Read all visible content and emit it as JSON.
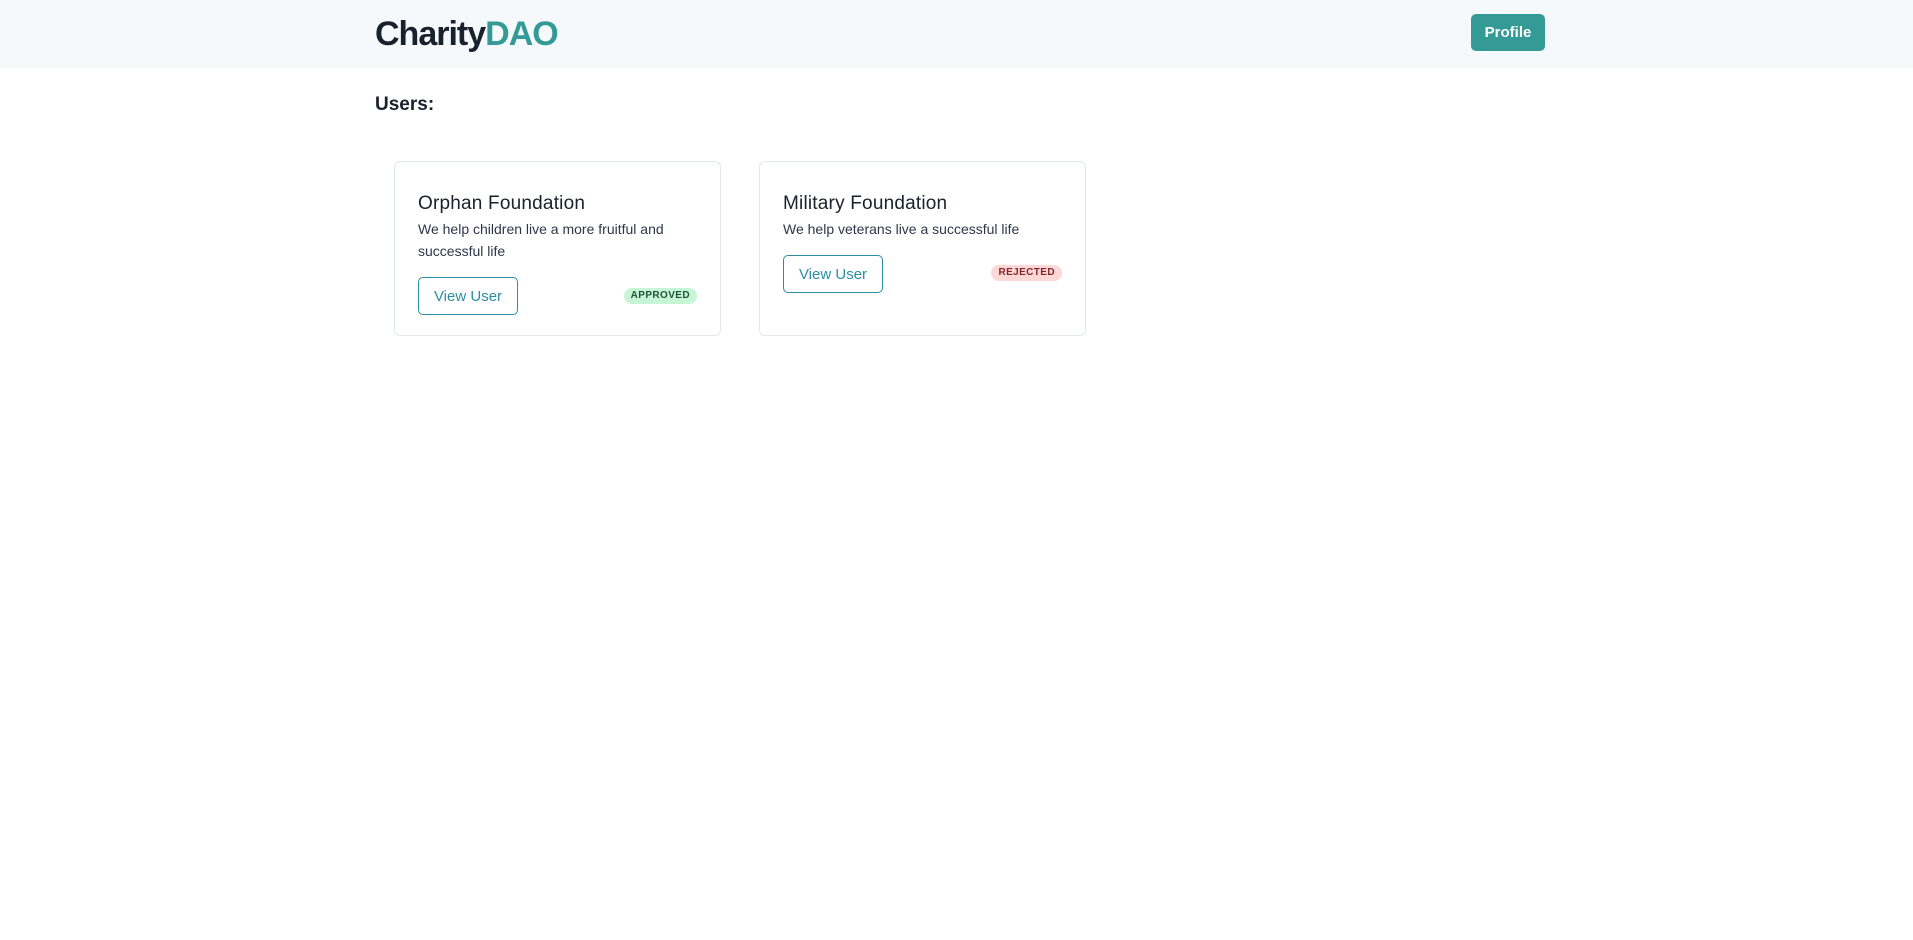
{
  "header": {
    "logo_part1": "Charity",
    "logo_part2": "DAO",
    "profile_label": "Profile"
  },
  "main": {
    "section_title": "Users:",
    "cards": [
      {
        "title": "Orphan Foundation",
        "description": "We help children live a more fruitful and successful life",
        "button_label": "View User",
        "status": "APPROVED"
      },
      {
        "title": "Military Foundation",
        "description": "We help veterans live a successful life",
        "button_label": "View User",
        "status": "REJECTED"
      }
    ]
  },
  "colors": {
    "brand": "#349a95",
    "header_bg": "#f5f9fc",
    "link_accent": "#2b8fa3",
    "approved_bg": "#c6f6d5",
    "approved_text": "#22543d",
    "rejected_bg": "#fed7d7",
    "rejected_text": "#822727"
  }
}
